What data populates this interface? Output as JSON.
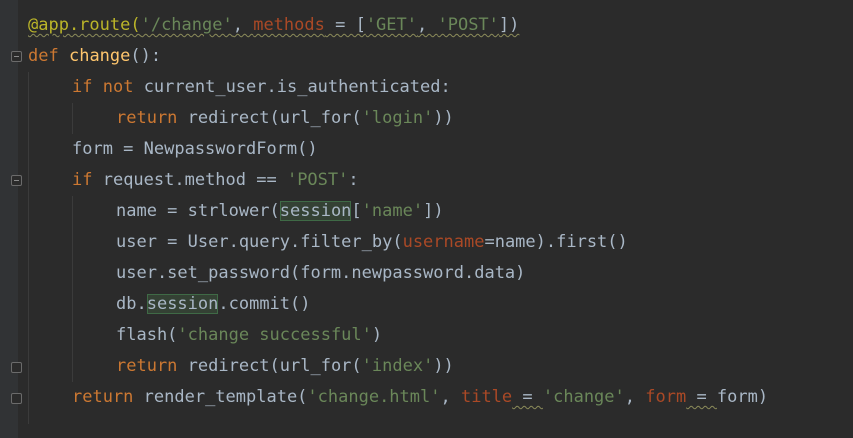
{
  "code": {
    "l1": {
      "deco": "@app.route(",
      "s1": "'/change'",
      "sep": ", ",
      "param": "methods",
      "eq": " = [",
      "s2": "'GET'",
      "comma": ", ",
      "s3": "'POST'",
      "end": "])"
    },
    "l2": {
      "kw": "def",
      "sp": " ",
      "fn": "change",
      "rest": "():"
    },
    "l3": {
      "kw1": "if",
      "sp1": " ",
      "kw2": "not",
      "rest": " current_user.is_authenticated:"
    },
    "l4": {
      "kw": "return",
      "a": " redirect(url_for(",
      "s": "'login'",
      "b": "))"
    },
    "l5": {
      "text": "form = NewpasswordForm()"
    },
    "l6": {
      "kw": "if",
      "a": " request.method == ",
      "s": "'POST'",
      "b": ":"
    },
    "l7": {
      "a": "name = strlower(",
      "hl": "session",
      "b": "[",
      "s": "'name'",
      "c": "])"
    },
    "l8": {
      "a": "user = User.query.filter_by(",
      "param": "username",
      "b": "=name).first()"
    },
    "l9": {
      "text": "user.set_password(form.newpassword.data)"
    },
    "l10": {
      "a": "db.",
      "hl": "session",
      "b": ".commit()"
    },
    "l11": {
      "a": "flash(",
      "s": "'change successful'",
      "b": ")"
    },
    "l12": {
      "kw": "return",
      "a": " redirect(url_for(",
      "s": "'index'",
      "b": "))"
    },
    "l13": {
      "kw": "return",
      "a": " render_template(",
      "s1": "'change.html'",
      "c1": ", ",
      "p1": "title",
      "e1": " = ",
      "s2": "'change'",
      "c2": ", ",
      "p2": "form",
      "e2": " = ",
      "b": "form)"
    }
  }
}
